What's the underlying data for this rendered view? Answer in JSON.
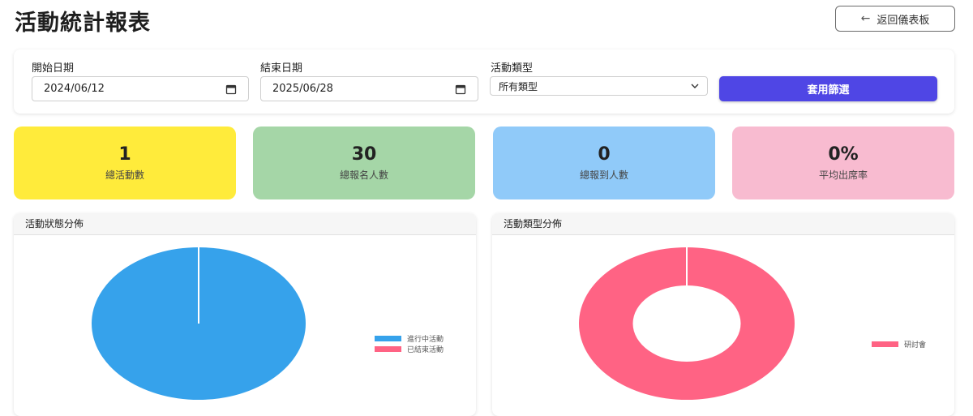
{
  "header": {
    "title": "活動統計報表",
    "back_label": "返回儀表板",
    "back_icon": "arrow-left-icon"
  },
  "filters": {
    "start_date_label": "開始日期",
    "start_date_value": "2024/06/12",
    "end_date_label": "結束日期",
    "end_date_value": "2025/06/28",
    "type_label": "活動類型",
    "type_selected": "所有類型",
    "apply_label": "套用篩選",
    "apply_color": "#4f46e5"
  },
  "stats": [
    {
      "value": "1",
      "label": "總活動數",
      "color": "#ffeb3b"
    },
    {
      "value": "30",
      "label": "總報名人數",
      "color": "#a5d6a7"
    },
    {
      "value": "0",
      "label": "總報到人數",
      "color": "#90caf9"
    },
    {
      "value": "0%",
      "label": "平均出席率",
      "color": "#f8bbd0"
    }
  ],
  "charts": {
    "status_title": "活動狀態分佈",
    "type_title": "活動類型分佈"
  },
  "chart_data": [
    {
      "type": "pie",
      "title": "活動狀態分佈",
      "categories": [
        "進行中活動",
        "已結束活動"
      ],
      "values": [
        1,
        0
      ],
      "colors": [
        "#36a2eb",
        "#ff6384"
      ],
      "legend": "right"
    },
    {
      "type": "pie",
      "variant": "doughnut",
      "title": "活動類型分佈",
      "categories": [
        "研討會"
      ],
      "values": [
        1
      ],
      "colors": [
        "#ff6384"
      ],
      "legend": "right"
    }
  ]
}
